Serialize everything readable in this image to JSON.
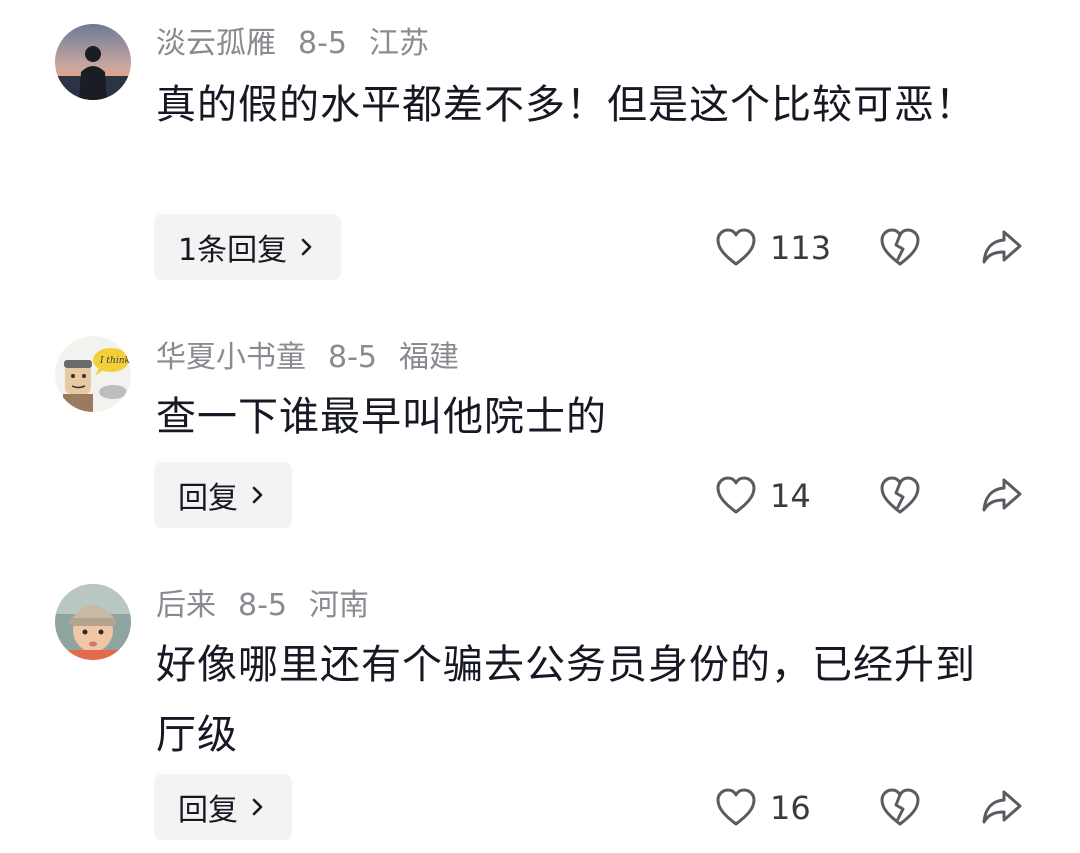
{
  "comments": [
    {
      "username": "淡云孤雁",
      "date": "8-5",
      "location": "江苏",
      "text": "真的假的水平都差不多！但是这个比较可恶！",
      "reply_label": "1条回复",
      "likes": "113",
      "avatar": "silhouette-sunset"
    },
    {
      "username": "华夏小书童",
      "date": "8-5",
      "location": "福建",
      "text": "查一下谁最早叫他院士的",
      "reply_label": "回复",
      "likes": "14",
      "avatar": "cartoon-i-think"
    },
    {
      "username": "后来",
      "date": "8-5",
      "location": "河南",
      "text": "好像哪里还有个骗去公务员身份的，已经升到厅级",
      "reply_label": "回复",
      "likes": "16",
      "avatar": "child-beanie"
    }
  ],
  "icons": {
    "like": "heart-icon",
    "dislike": "broken-heart-icon",
    "share": "share-arrow-icon",
    "reply_chevron": "chevron-right-icon"
  },
  "colors": {
    "meta": "#8a8b91",
    "text": "#161823",
    "reply_bg": "#f3f3f4"
  }
}
